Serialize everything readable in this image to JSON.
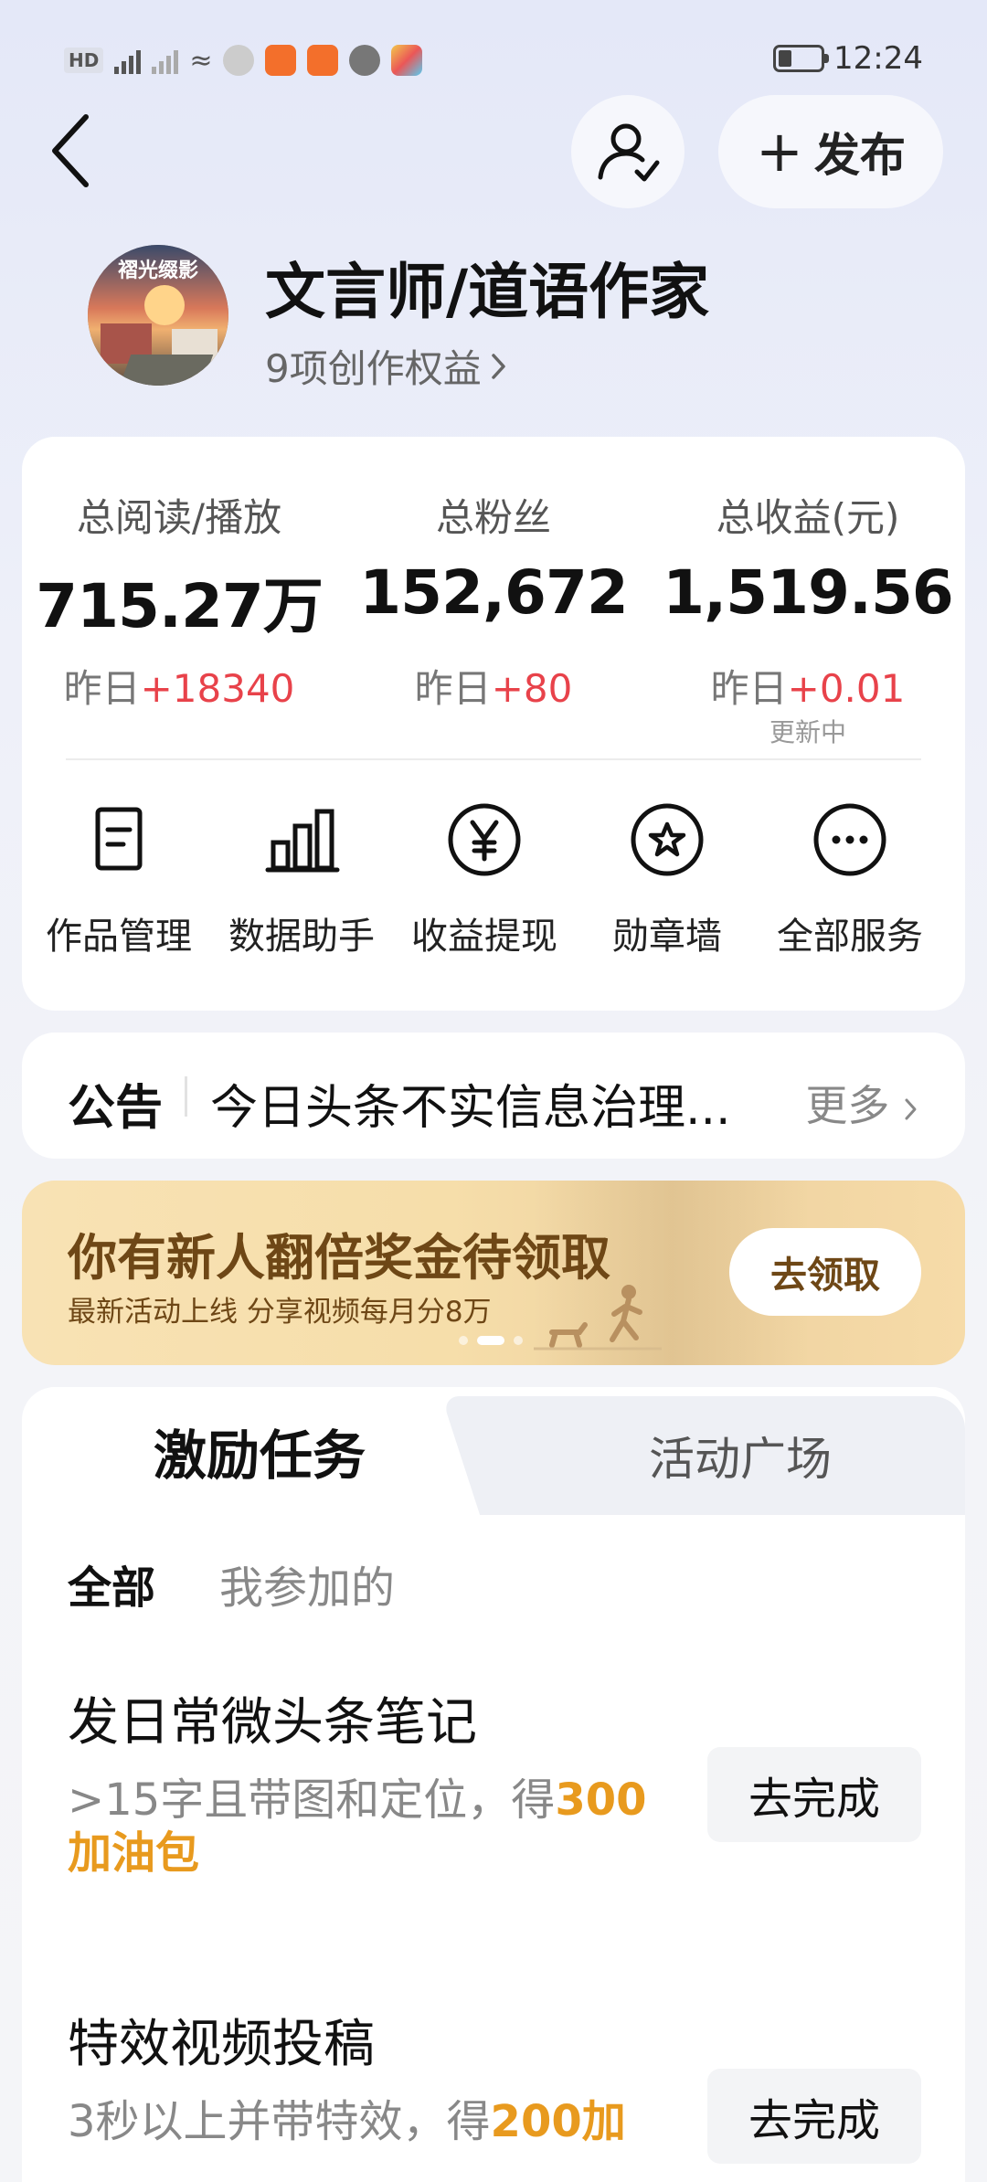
{
  "status_bar": {
    "time": "12:24",
    "network_type": "HD",
    "signal": "5G",
    "colors": {
      "app_orange": "#f36f2b",
      "app_multicolor": "#f2c94c"
    }
  },
  "header": {
    "publish_label": "发布"
  },
  "profile": {
    "name": "文言师/道语作家",
    "rights_link": "9项创作权益",
    "avatar_caption": "褶光缀影"
  },
  "stats": [
    {
      "label": "总阅读/播放",
      "value": "715.27万",
      "yesterday_prefix": "昨日",
      "yesterday_delta": "+18340"
    },
    {
      "label": "总粉丝",
      "value": "152,672",
      "yesterday_prefix": "昨日",
      "yesterday_delta": "+80"
    },
    {
      "label": "总收益(元)",
      "value": "1,519.56",
      "yesterday_prefix": "昨日",
      "yesterday_delta": "+0.01",
      "note": "更新中"
    }
  ],
  "services": [
    {
      "label": "作品管理",
      "icon": "document-icon"
    },
    {
      "label": "数据助手",
      "icon": "bar-chart-icon"
    },
    {
      "label": "收益提现",
      "icon": "yen-coin-icon"
    },
    {
      "label": "勋章墙",
      "icon": "medal-star-icon"
    },
    {
      "label": "全部服务",
      "icon": "more-dots-icon"
    }
  ],
  "notice": {
    "tag": "公告",
    "text": "今日头条不实信息治理...",
    "more": "更多"
  },
  "banner": {
    "title": "你有新人翻倍奖金待领取",
    "subtitle": "最新活动上线 分享视频每月分8万",
    "cta": "去领取"
  },
  "tasks": {
    "tabs": [
      "激励任务",
      "活动广场"
    ],
    "filters": [
      "全部",
      "我参加的"
    ],
    "items": [
      {
        "title": "发日常微头条笔记",
        "desc_plain": ">15字且带图和定位，得",
        "desc_highlight": "300加油包",
        "action": "去完成"
      },
      {
        "title": "特效视频投稿",
        "desc_plain": "3秒以上并带特效，得",
        "desc_highlight": "200加",
        "action": "去完成"
      }
    ]
  },
  "colors": {
    "accent_red": "#e8424a",
    "reward_orange": "#e89a1e",
    "banner_text": "#6e4716"
  }
}
